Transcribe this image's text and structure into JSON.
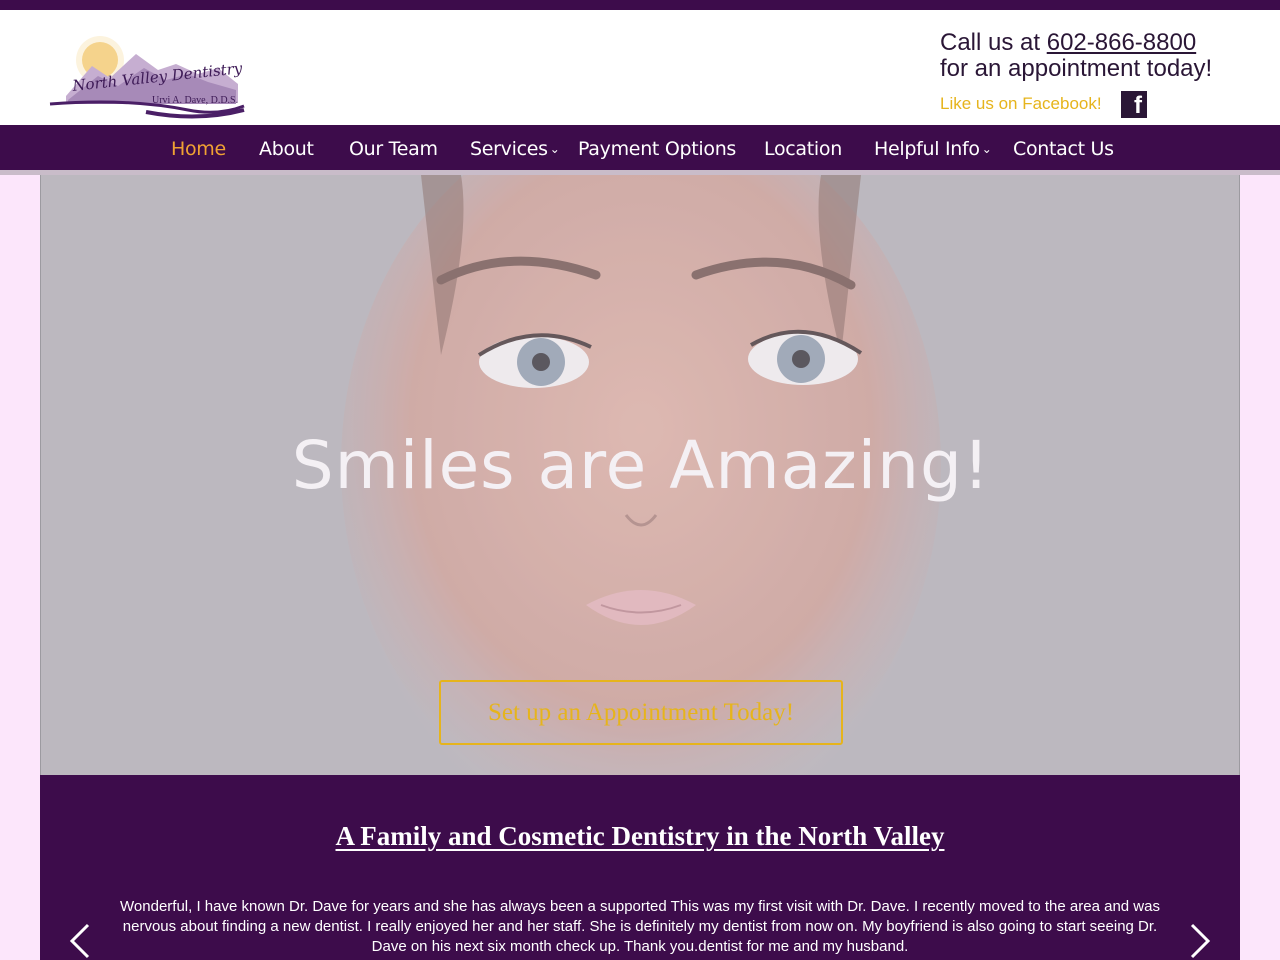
{
  "header": {
    "logo_name": "North Valley Dentistry",
    "logo_doctor": "Urvi A. Dave, D.D.S.",
    "call_prefix": "Call us at ",
    "phone": "602-866-8800",
    "call_suffix": "for an appointment today!",
    "facebook_text": "Like us on Facebook!",
    "facebook_glyph": "f"
  },
  "nav": {
    "items": [
      {
        "label": "Home"
      },
      {
        "label": "About"
      },
      {
        "label": "Our Team"
      },
      {
        "label": "Services"
      },
      {
        "label": "Payment Options"
      },
      {
        "label": "Location"
      },
      {
        "label": "Helpful Info"
      },
      {
        "label": "Contact Us"
      }
    ],
    "chevron": "⌄"
  },
  "hero": {
    "title": "Smiles are Amazing!",
    "cta_label": "Set up an Appointment Today!"
  },
  "section": {
    "title": "A Family and Cosmetic Dentistry in the North Valley",
    "testimonial": "Wonderful, I have known Dr. Dave for years and she has always been a supported This was my first visit with Dr. Dave. I recently moved to the area and was nervous about finding a new dentist. I really enjoyed her and her staff. She is definitely my dentist from now on. My boyfriend is also going to start seeing Dr. Dave on his next six month check up. Thank you.dentist for me and my husband."
  },
  "colors": {
    "brand_purple": "#3d0c4b",
    "accent_gold": "#e6b41c",
    "active_orange": "#f0a233",
    "page_bg": "#fce6fb"
  },
  "icons": [
    "facebook-icon",
    "chevron-down-icon",
    "chevron-left-icon",
    "chevron-right-icon"
  ]
}
